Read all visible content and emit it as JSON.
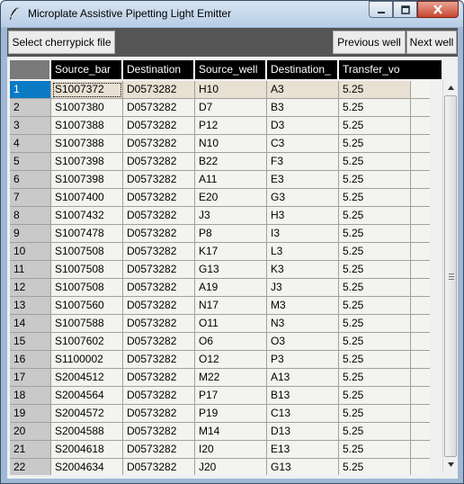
{
  "window": {
    "title": "Microplate Assistive Pipetting Light Emitter",
    "icon": "feather-icon"
  },
  "toolbar": {
    "select_label": "Select cherrypick file",
    "prev_label": "Previous well",
    "next_label": "Next well"
  },
  "table": {
    "columns": [
      "Source_bar",
      "Destination",
      "Source_well",
      "Destination_",
      "Transfer_vo"
    ],
    "selected_row": 1,
    "rows": [
      {
        "n": "1",
        "source_bar": "S1007372",
        "destination": "D0573282",
        "source_well": "H10",
        "dest_well": "A3",
        "volume": "5.25"
      },
      {
        "n": "2",
        "source_bar": "S1007380",
        "destination": "D0573282",
        "source_well": "D7",
        "dest_well": "B3",
        "volume": "5.25"
      },
      {
        "n": "3",
        "source_bar": "S1007388",
        "destination": "D0573282",
        "source_well": "P12",
        "dest_well": "D3",
        "volume": "5.25"
      },
      {
        "n": "4",
        "source_bar": "S1007388",
        "destination": "D0573282",
        "source_well": "N10",
        "dest_well": "C3",
        "volume": "5.25"
      },
      {
        "n": "5",
        "source_bar": "S1007398",
        "destination": "D0573282",
        "source_well": "B22",
        "dest_well": "F3",
        "volume": "5.25"
      },
      {
        "n": "6",
        "source_bar": "S1007398",
        "destination": "D0573282",
        "source_well": "A11",
        "dest_well": "E3",
        "volume": "5.25"
      },
      {
        "n": "7",
        "source_bar": "S1007400",
        "destination": "D0573282",
        "source_well": "E20",
        "dest_well": "G3",
        "volume": "5.25"
      },
      {
        "n": "8",
        "source_bar": "S1007432",
        "destination": "D0573282",
        "source_well": "J3",
        "dest_well": "H3",
        "volume": "5.25"
      },
      {
        "n": "9",
        "source_bar": "S1007478",
        "destination": "D0573282",
        "source_well": "P8",
        "dest_well": "I3",
        "volume": "5.25"
      },
      {
        "n": "10",
        "source_bar": "S1007508",
        "destination": "D0573282",
        "source_well": "K17",
        "dest_well": "L3",
        "volume": "5.25"
      },
      {
        "n": "11",
        "source_bar": "S1007508",
        "destination": "D0573282",
        "source_well": "G13",
        "dest_well": "K3",
        "volume": "5.25"
      },
      {
        "n": "12",
        "source_bar": "S1007508",
        "destination": "D0573282",
        "source_well": "A19",
        "dest_well": "J3",
        "volume": "5.25"
      },
      {
        "n": "13",
        "source_bar": "S1007560",
        "destination": "D0573282",
        "source_well": "N17",
        "dest_well": "M3",
        "volume": "5.25"
      },
      {
        "n": "14",
        "source_bar": "S1007588",
        "destination": "D0573282",
        "source_well": "O11",
        "dest_well": "N3",
        "volume": "5.25"
      },
      {
        "n": "15",
        "source_bar": "S1007602",
        "destination": "D0573282",
        "source_well": "O6",
        "dest_well": "O3",
        "volume": "5.25"
      },
      {
        "n": "16",
        "source_bar": "S1100002",
        "destination": "D0573282",
        "source_well": "O12",
        "dest_well": "P3",
        "volume": "5.25"
      },
      {
        "n": "17",
        "source_bar": "S2004512",
        "destination": "D0573282",
        "source_well": "M22",
        "dest_well": "A13",
        "volume": "5.25"
      },
      {
        "n": "18",
        "source_bar": "S2004564",
        "destination": "D0573282",
        "source_well": "P17",
        "dest_well": "B13",
        "volume": "5.25"
      },
      {
        "n": "19",
        "source_bar": "S2004572",
        "destination": "D0573282",
        "source_well": "P19",
        "dest_well": "C13",
        "volume": "5.25"
      },
      {
        "n": "20",
        "source_bar": "S2004588",
        "destination": "D0573282",
        "source_well": "M14",
        "dest_well": "D13",
        "volume": "5.25"
      },
      {
        "n": "21",
        "source_bar": "S2004618",
        "destination": "D0573282",
        "source_well": "I20",
        "dest_well": "E13",
        "volume": "5.25"
      },
      {
        "n": "22",
        "source_bar": "S2004634",
        "destination": "D0573282",
        "source_well": "J20",
        "dest_well": "G13",
        "volume": "5.25"
      }
    ]
  },
  "colors": {
    "selection_index": "#0a7ac4",
    "selection_row": "#e8e0d2",
    "client_background": "#555555",
    "header_background": "#000000"
  }
}
